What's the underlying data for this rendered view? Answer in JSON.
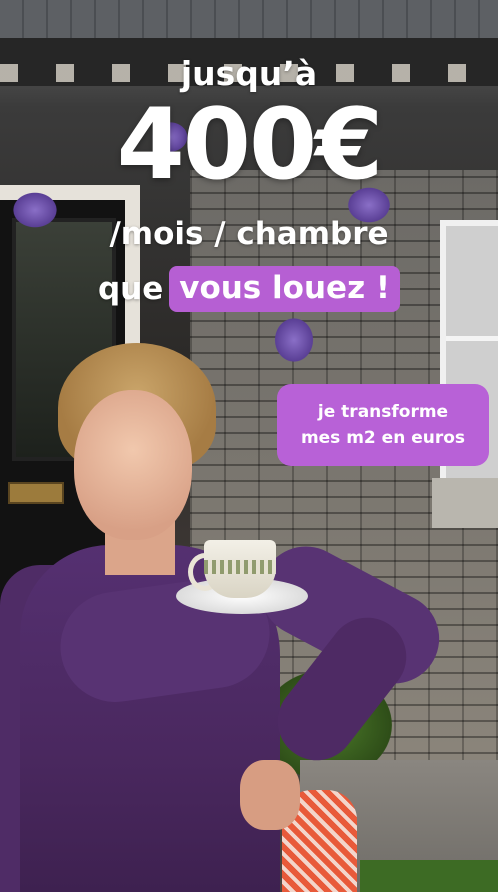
{
  "headline": {
    "prefix": "jusqu’à",
    "amount": "400€",
    "unit": "/mois / chambre",
    "que": "que",
    "highlight": "vous louez !"
  },
  "cta": {
    "line1": "je transforme",
    "line2": "mes m2 en euros"
  },
  "colors": {
    "accent": "#b861d7",
    "text": "#ffffff"
  }
}
